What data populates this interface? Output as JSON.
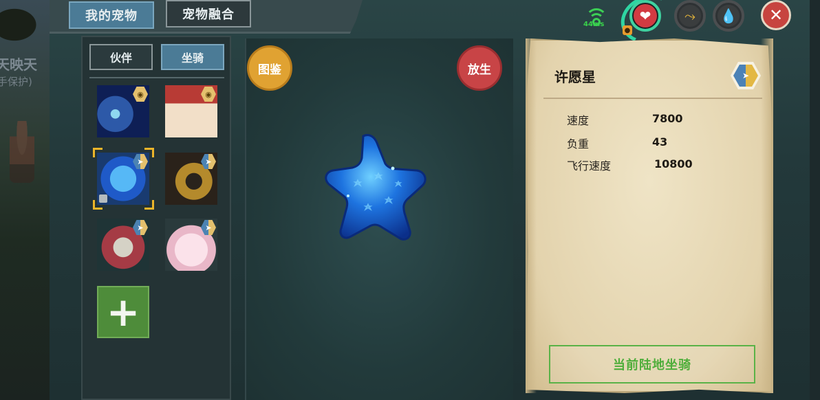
{
  "world": {
    "text_line1": "天映天",
    "text_line2": "手保护)"
  },
  "tabs": {
    "my_pets": "我的宠物",
    "pet_fusion": "宠物融合"
  },
  "status": {
    "ping": "44ms"
  },
  "list": {
    "sub_tabs": {
      "partner": "伙伴",
      "mount": "坐骑"
    },
    "add_label": "+"
  },
  "preview": {
    "codex_label": "图鉴",
    "release_label": "放生"
  },
  "details": {
    "name": "许愿星",
    "stats": [
      {
        "label": "速度",
        "value": "7800"
      },
      {
        "label": "负重",
        "value": "43"
      },
      {
        "label": "飞行速度",
        "value": "10800"
      }
    ],
    "action_label": "当前陆地坐骑"
  },
  "colors": {
    "accent_blue": "#4b7b96",
    "health": "#d23b42",
    "stamina_ring": "#2fd5a2",
    "action_green": "#4fae3b",
    "close_red": "#c7443f"
  }
}
